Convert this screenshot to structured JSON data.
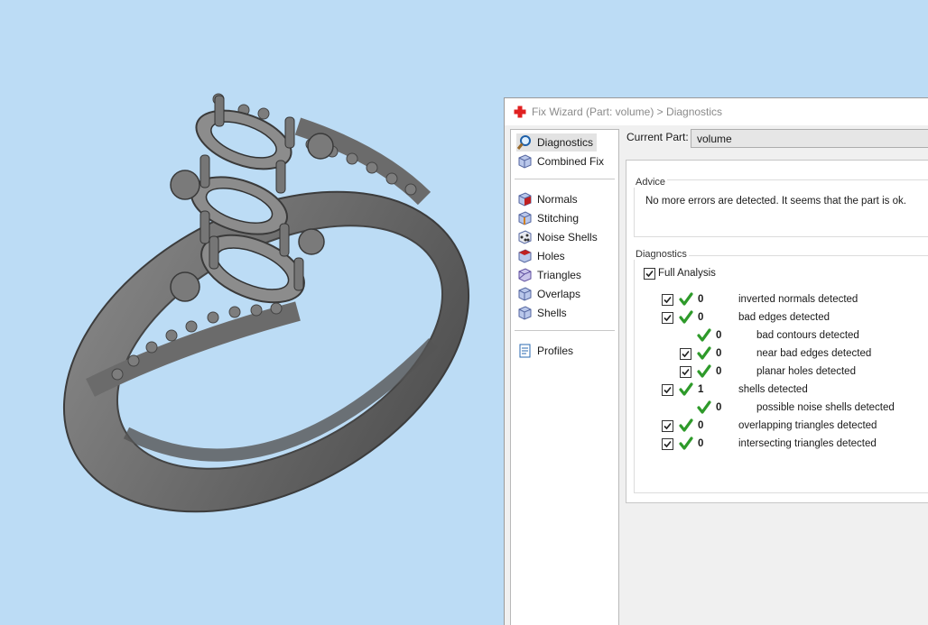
{
  "window": {
    "title": "Fix Wizard (Part: volume) > Diagnostics"
  },
  "sidebar": {
    "items": [
      {
        "label": "Diagnostics",
        "icon": "magnifier-icon"
      },
      {
        "label": "Combined Fix",
        "icon": "cube-icon"
      },
      {
        "label": "Normals",
        "icon": "normals-cube-icon"
      },
      {
        "label": "Stitching",
        "icon": "stitching-cube-icon"
      },
      {
        "label": "Noise Shells",
        "icon": "noise-shells-icon"
      },
      {
        "label": "Holes",
        "icon": "holes-cube-icon"
      },
      {
        "label": "Triangles",
        "icon": "triangles-cube-icon"
      },
      {
        "label": "Overlaps",
        "icon": "overlaps-cube-icon"
      },
      {
        "label": "Shells",
        "icon": "shells-cube-icon"
      },
      {
        "label": "Profiles",
        "icon": "document-icon"
      }
    ]
  },
  "current_part": {
    "label": "Current Part:",
    "value": "volume"
  },
  "advice": {
    "title": "Advice",
    "text": "No more errors are detected. It seems that the part is ok."
  },
  "diagnostics": {
    "title": "Diagnostics",
    "full_analysis_label": "Full Analysis",
    "rows": [
      {
        "count": "0",
        "label": "inverted normals detected"
      },
      {
        "count": "0",
        "label": "bad edges detected"
      },
      {
        "count": "0",
        "label": "bad contours detected"
      },
      {
        "count": "0",
        "label": "near bad edges detected"
      },
      {
        "count": "0",
        "label": "planar holes detected"
      },
      {
        "count": "1",
        "label": "shells detected"
      },
      {
        "count": "0",
        "label": "possible noise shells detected"
      },
      {
        "count": "0",
        "label": "overlapping triangles detected"
      },
      {
        "count": "0",
        "label": "intersecting triangles detected"
      }
    ]
  },
  "colors": {
    "background": "#bcdcf5",
    "check_green": "#2e9a2a",
    "app_icon_red": "#e02020"
  }
}
